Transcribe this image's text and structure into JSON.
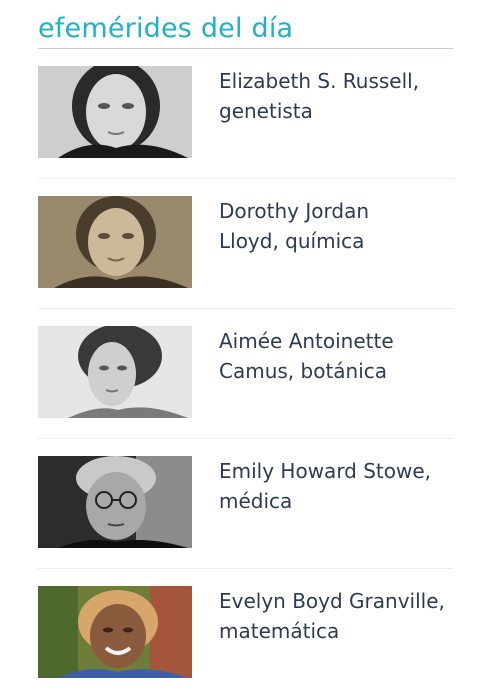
{
  "widget": {
    "title": "efemérides del día",
    "entries": [
      {
        "line1": "Elizabeth S. Russell,",
        "line2": "genetista",
        "portrait": "portrait-photo-elizabeth-s-russell"
      },
      {
        "line1": "Dorothy Jordan",
        "line2": "Lloyd, química",
        "portrait": "portrait-photo-dorothy-jordan-lloyd"
      },
      {
        "line1": "Aimée Antoinette",
        "line2": "Camus, botánica",
        "portrait": "portrait-photo-aimee-antoinette-camus"
      },
      {
        "line1": "Emily Howard Stowe,",
        "line2": "médica",
        "portrait": "portrait-photo-emily-howard-stowe"
      },
      {
        "line1": "Evelyn Boyd Granville,",
        "line2": "matemática",
        "portrait": "portrait-photo-evelyn-boyd-granville"
      }
    ]
  },
  "colors": {
    "title": "#1fb1c6",
    "text": "#2e3b55",
    "title_rule": "#d7c6cf",
    "separator": "#ececec"
  }
}
